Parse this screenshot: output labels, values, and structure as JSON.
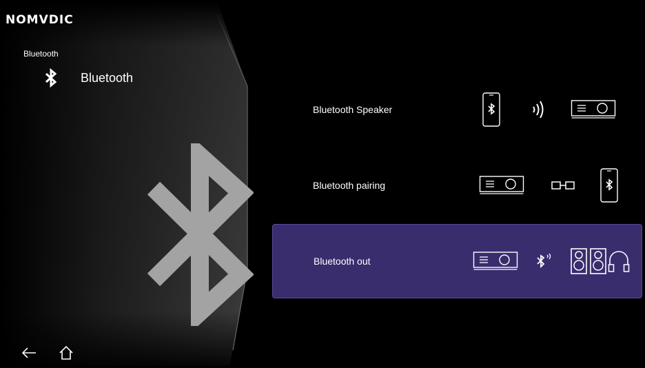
{
  "brand": {
    "logo": "NOMVDIC"
  },
  "breadcrumb": "Bluetooth",
  "category": {
    "label": "Bluetooth",
    "icon": "bluetooth-icon"
  },
  "options": [
    {
      "label": "Bluetooth Speaker",
      "icons": [
        "phone-bluetooth-icon",
        "signal-waves-icon",
        "projector-icon"
      ]
    },
    {
      "label": "Bluetooth pairing",
      "icons": [
        "projector-icon",
        "link-icon",
        "phone-bluetooth-icon"
      ]
    },
    {
      "label": "Bluetooth out",
      "icons": [
        "projector-icon",
        "bluetooth-signal-icon",
        "speakers-icon",
        "headphones-icon"
      ],
      "selected": true
    }
  ],
  "nav": {
    "back_icon": "back-arrow-icon",
    "home_icon": "home-icon"
  },
  "colors": {
    "selected_bg": "#3a2d6e",
    "background": "#000000",
    "panel": "#2a2a2a"
  }
}
